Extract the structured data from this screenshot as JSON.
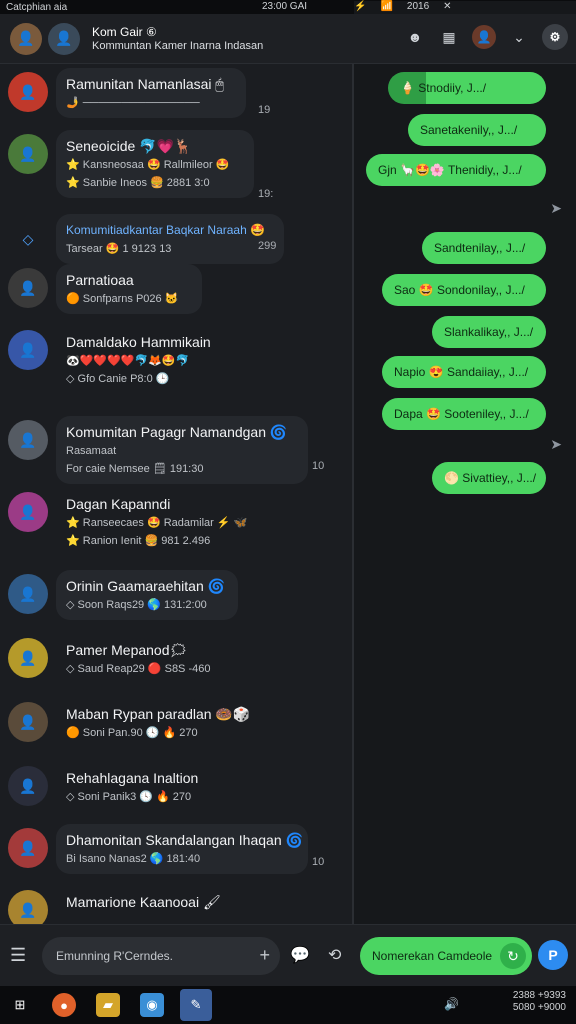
{
  "statusbar": {
    "app": "Catcphian aia",
    "time": "23:00 GAI",
    "battery": "2016"
  },
  "header": {
    "title": "Kom Gair ⑥",
    "subtitle": "Kommuntan Kamer Inarna Indasan"
  },
  "chats": [
    {
      "name": "Ramunitan Namanlasai 🖱",
      "meta": "🤳 ───────────────",
      "time": "19",
      "color": "#c0392b"
    },
    {
      "name": "Seneoicide  🐬💗🦌",
      "meta": "⭐ Kansneosaa  🤩 Rallmileor 🤩",
      "meta2": "⭐ Sanbie Ineos 🍔 2881 3:0",
      "time": "19:",
      "color": "#4a7a3a"
    },
    {
      "name": "Komumitiadkantar Baqkar Naraah 🤩",
      "meta": "Tarsear 🤩 1 9123 13",
      "time": "299",
      "blue": true,
      "color": "#2d6fb0"
    },
    {
      "name": "Parnatioaa",
      "meta": "🟠 Sonfparns P026 🐱",
      "time": "",
      "color": "#3a3a3a"
    },
    {
      "name": "Damaldako Hammikain",
      "meta": "🐼❤️❤️❤️❤️🐬🦊🤩🐬",
      "meta2": "◇ Gfo Canie P8:0 🕒",
      "time": "",
      "color": "#3757a8"
    },
    {
      "name": "Komumitan Pagagr Namandgan 🌀",
      "meta": "Rasamaat",
      "meta2": "For caie Nemsee 🗒 191:30",
      "time": "10",
      "color": "#555b63"
    },
    {
      "name": "Dagan Kapanndi",
      "meta": "⭐ Ranseecaes 🤩 Radamilar ⚡ 🦋",
      "meta2": "⭐ Ranion Ienit 🍔 981 2.496",
      "time": "",
      "color": "#9b3b86"
    },
    {
      "name": "Orinin Gaamaraehitan 🌀",
      "meta": "◇ Soon Raqs29 🌎 131:2:00",
      "time": "",
      "color": "#2f5a87"
    },
    {
      "name": "Pamer Mepanod🗯",
      "meta": "◇ Saud Reap29 🔴 S8S -460",
      "time": "",
      "color": "#b59a2a"
    },
    {
      "name": "Maban Rypan paradlan 🍩🎲",
      "meta": "🟠 Soni Pan.90 🕓 🔥 270",
      "time": "",
      "color": "#5a4b3a"
    },
    {
      "name": "Rehahlagana Inaltion",
      "meta": "◇ Soni Panik3 🕓 🔥 270",
      "time": "",
      "color": "#2a2d3a"
    },
    {
      "name": "Dhamonitan Skandalangan Ihaqan 🌀",
      "meta": "Bi Isano Nanas2 🌎 181:40",
      "time": "10",
      "color": "#a33a3a"
    },
    {
      "name": "Mamarione Kaanooai 🖌",
      "meta": "",
      "time": "",
      "color": "#a8842f"
    }
  ],
  "outgoing": [
    "🍦 Stnodiiy, J.../",
    "Sanetakenily,, J.../",
    "Gjn 🦙🤩🌸 Thenidiy,, J.../",
    "Sandtenilay,, J.../",
    "Sao 🤩 Sondonilay,, J.../",
    "Slankalikay,, J.../",
    "Napio 😍 Sandaiiay,, J.../",
    "Dapa 🤩 Sooteniley,, J.../",
    "🌕 Sivattiey,, J.../"
  ],
  "composer": {
    "placeholder": "Emunning R'Cerndes.",
    "send_label": "Nomerekan Camdeole"
  },
  "taskbar": {
    "tray_line1": "2388  +9393",
    "tray_line2": "5080  +9000"
  }
}
